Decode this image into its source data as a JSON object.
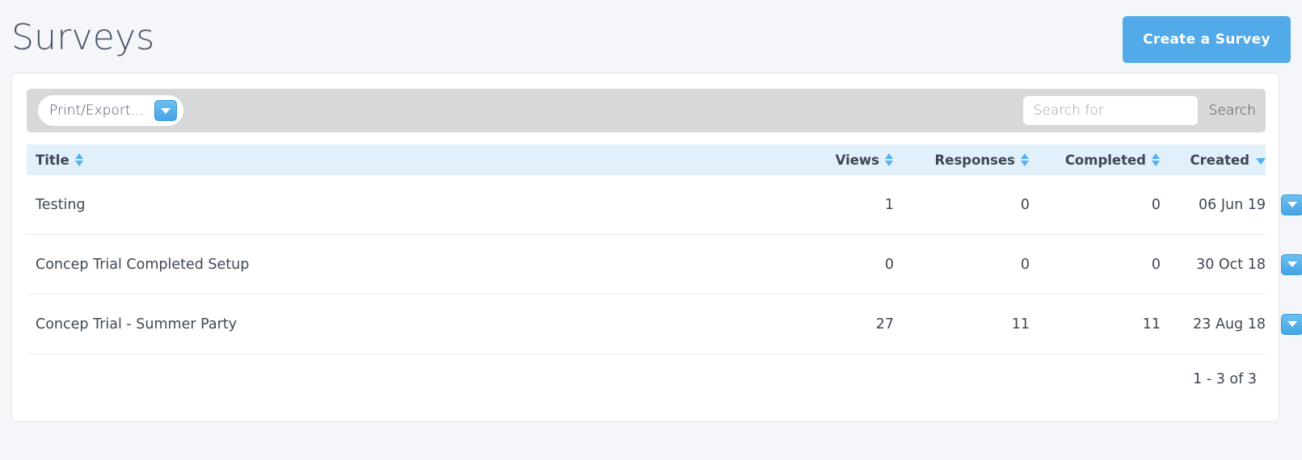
{
  "header": {
    "title": "Surveys",
    "create_button_label": "Create a Survey"
  },
  "toolbar": {
    "export_label": "Print/Export...",
    "export_caret_icon": "chevron-down-icon",
    "search_placeholder": "Search for",
    "search_value": "",
    "search_button_label": "Search"
  },
  "table": {
    "columns": [
      {
        "label": "Title",
        "sort": "none"
      },
      {
        "label": "Views",
        "sort": "none"
      },
      {
        "label": "Responses",
        "sort": "none"
      },
      {
        "label": "Completed",
        "sort": "none"
      },
      {
        "label": "Created",
        "sort": "desc"
      }
    ],
    "rows": [
      {
        "title": "Testing",
        "views": "1",
        "responses": "0",
        "completed": "0",
        "created": "06 Jun 19",
        "action_icon": "chevron-down-icon"
      },
      {
        "title": "Concep Trial Completed Setup",
        "views": "0",
        "responses": "0",
        "completed": "0",
        "created": "30 Oct 18",
        "action_icon": "chevron-down-icon"
      },
      {
        "title": "Concep Trial - Summer Party",
        "views": "27",
        "responses": "11",
        "completed": "11",
        "created": "23 Aug 18",
        "action_icon": "chevron-down-icon"
      }
    ],
    "pagination_info": "1 - 3 of 3"
  },
  "colors": {
    "accent_blue": "#52aae8",
    "page_background": "#f4f6f9",
    "toolbar_gray": "#d7d8d9",
    "header_row_blue": "#e2f0fb",
    "text_dark": "#3d4754"
  }
}
